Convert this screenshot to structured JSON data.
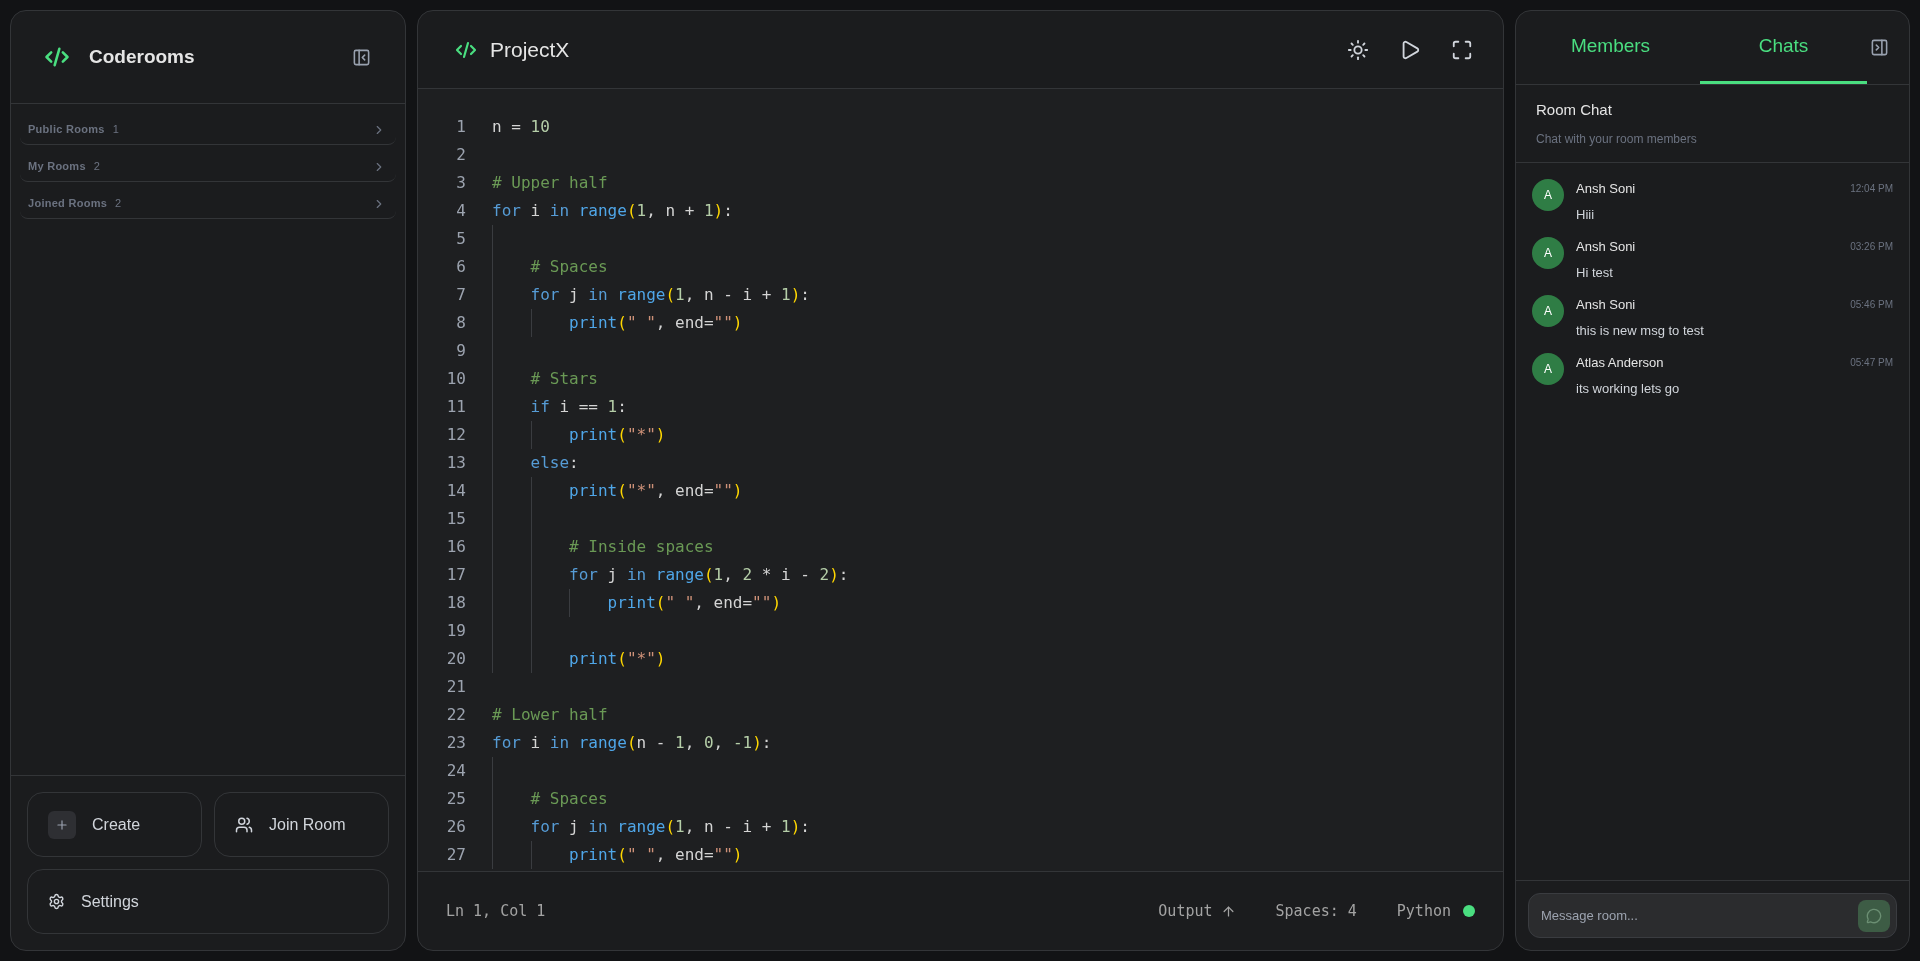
{
  "sidebar": {
    "brand": "Coderooms",
    "sections": [
      {
        "label": "Public Rooms",
        "count": "1"
      },
      {
        "label": "My Rooms",
        "count": "2"
      },
      {
        "label": "Joined Rooms",
        "count": "2"
      }
    ],
    "actions": [
      {
        "label": "Create",
        "kind": "create"
      },
      {
        "label": "Join Room",
        "kind": "join"
      },
      {
        "label": "Settings",
        "kind": "settings"
      }
    ]
  },
  "editor": {
    "title": "ProjectX",
    "lines": [
      {
        "number": "1",
        "tokens": [
          {
            "text": "n = ",
            "kind": "tx"
          },
          {
            "text": "10",
            "kind": "num"
          }
        ]
      },
      {
        "number": "2"
      },
      {
        "number": "3",
        "tokens": [
          {
            "text": "# Upper half",
            "kind": "cm"
          }
        ]
      },
      {
        "number": "4",
        "tokens": [
          {
            "text": "for",
            "kind": "kw"
          },
          {
            "text": " i ",
            "kind": "tx"
          },
          {
            "text": "in ",
            "kind": "kw"
          },
          {
            "text": "range",
            "kind": "fn"
          },
          {
            "text": "(",
            "kind": "pn"
          },
          {
            "text": "1",
            "kind": "num"
          },
          {
            "text": ", n + ",
            "kind": "tx"
          },
          {
            "text": "1",
            "kind": "num"
          },
          {
            "text": ")",
            "kind": "pn"
          },
          {
            "text": ":",
            "kind": "tx"
          }
        ]
      },
      {
        "number": "5"
      },
      {
        "number": "6",
        "tokens": [
          {
            "text": "    # Spaces",
            "kind": "cm"
          }
        ]
      },
      {
        "number": "7",
        "tokens": [
          {
            "text": "    for",
            "kind": "kw"
          },
          {
            "text": " j ",
            "kind": "tx"
          },
          {
            "text": "in ",
            "kind": "kw"
          },
          {
            "text": "range",
            "kind": "fn"
          },
          {
            "text": "(",
            "kind": "pn"
          },
          {
            "text": "1",
            "kind": "num"
          },
          {
            "text": ", n - i + ",
            "kind": "tx"
          },
          {
            "text": "1",
            "kind": "num"
          },
          {
            "text": ")",
            "kind": "pn"
          },
          {
            "text": ":",
            "kind": "tx"
          }
        ]
      },
      {
        "number": "8",
        "tokens": [
          {
            "text": "        print",
            "kind": "fn"
          },
          {
            "text": "(",
            "kind": "pn"
          },
          {
            "text": "\" \"",
            "kind": "str"
          },
          {
            "text": ", end=",
            "kind": "tx"
          },
          {
            "text": "\"\"",
            "kind": "str"
          },
          {
            "text": ")",
            "kind": "pn"
          }
        ]
      },
      {
        "number": "9"
      },
      {
        "number": "10",
        "tokens": [
          {
            "text": "    # Stars",
            "kind": "cm"
          }
        ]
      },
      {
        "number": "11",
        "tokens": [
          {
            "text": "    if",
            "kind": "kw"
          },
          {
            "text": " i == ",
            "kind": "tx"
          },
          {
            "text": "1",
            "kind": "num"
          },
          {
            "text": ":",
            "kind": "tx"
          }
        ]
      },
      {
        "number": "12",
        "tokens": [
          {
            "text": "        print",
            "kind": "fn"
          },
          {
            "text": "(",
            "kind": "pn"
          },
          {
            "text": "\"*\"",
            "kind": "str"
          },
          {
            "text": ")",
            "kind": "pn"
          }
        ]
      },
      {
        "number": "13",
        "tokens": [
          {
            "text": "    else",
            "kind": "kw"
          },
          {
            "text": ":",
            "kind": "tx"
          }
        ]
      },
      {
        "number": "14",
        "tokens": [
          {
            "text": "        print",
            "kind": "fn"
          },
          {
            "text": "(",
            "kind": "pn"
          },
          {
            "text": "\"*\"",
            "kind": "str"
          },
          {
            "text": ", end=",
            "kind": "tx"
          },
          {
            "text": "\"\"",
            "kind": "str"
          },
          {
            "text": ")",
            "kind": "pn"
          }
        ]
      },
      {
        "number": "15"
      },
      {
        "number": "16",
        "tokens": [
          {
            "text": "        # Inside spaces",
            "kind": "cm"
          }
        ]
      },
      {
        "number": "17",
        "tokens": [
          {
            "text": "        for",
            "kind": "kw"
          },
          {
            "text": " j ",
            "kind": "tx"
          },
          {
            "text": "in ",
            "kind": "kw"
          },
          {
            "text": "range",
            "kind": "fn"
          },
          {
            "text": "(",
            "kind": "pn"
          },
          {
            "text": "1",
            "kind": "num"
          },
          {
            "text": ", ",
            "kind": "tx"
          },
          {
            "text": "2",
            "kind": "num"
          },
          {
            "text": " * i - ",
            "kind": "tx"
          },
          {
            "text": "2",
            "kind": "num"
          },
          {
            "text": ")",
            "kind": "pn"
          },
          {
            "text": ":",
            "kind": "tx"
          }
        ]
      },
      {
        "number": "18",
        "tokens": [
          {
            "text": "            print",
            "kind": "fn"
          },
          {
            "text": "(",
            "kind": "pn"
          },
          {
            "text": "\" \"",
            "kind": "str"
          },
          {
            "text": ", end=",
            "kind": "tx"
          },
          {
            "text": "\"\"",
            "kind": "str"
          },
          {
            "text": ")",
            "kind": "pn"
          }
        ]
      },
      {
        "number": "19"
      },
      {
        "number": "20",
        "tokens": [
          {
            "text": "        print",
            "kind": "fn"
          },
          {
            "text": "(",
            "kind": "pn"
          },
          {
            "text": "\"*\"",
            "kind": "str"
          },
          {
            "text": ")",
            "kind": "pn"
          }
        ]
      },
      {
        "number": "21"
      },
      {
        "number": "22",
        "tokens": [
          {
            "text": "# Lower half",
            "kind": "cm"
          }
        ]
      },
      {
        "number": "23",
        "tokens": [
          {
            "text": "for",
            "kind": "kw"
          },
          {
            "text": " i ",
            "kind": "tx"
          },
          {
            "text": "in ",
            "kind": "kw"
          },
          {
            "text": "range",
            "kind": "fn"
          },
          {
            "text": "(",
            "kind": "pn"
          },
          {
            "text": "n - ",
            "kind": "tx"
          },
          {
            "text": "1",
            "kind": "num"
          },
          {
            "text": ", ",
            "kind": "tx"
          },
          {
            "text": "0",
            "kind": "num"
          },
          {
            "text": ", ",
            "kind": "tx"
          },
          {
            "text": "-1",
            "kind": "num"
          },
          {
            "text": ")",
            "kind": "pn"
          },
          {
            "text": ":",
            "kind": "tx"
          }
        ]
      },
      {
        "number": "24"
      },
      {
        "number": "25",
        "tokens": [
          {
            "text": "    # Spaces",
            "kind": "cm"
          }
        ]
      },
      {
        "number": "26",
        "tokens": [
          {
            "text": "    for",
            "kind": "kw"
          },
          {
            "text": " j ",
            "kind": "tx"
          },
          {
            "text": "in ",
            "kind": "kw"
          },
          {
            "text": "range",
            "kind": "fn"
          },
          {
            "text": "(",
            "kind": "pn"
          },
          {
            "text": "1",
            "kind": "num"
          },
          {
            "text": ", n - i + ",
            "kind": "tx"
          },
          {
            "text": "1",
            "kind": "num"
          },
          {
            "text": ")",
            "kind": "pn"
          },
          {
            "text": ":",
            "kind": "tx"
          }
        ]
      },
      {
        "number": "27",
        "tokens": [
          {
            "text": "        print",
            "kind": "fn"
          },
          {
            "text": "(",
            "kind": "pn"
          },
          {
            "text": "\" \"",
            "kind": "str"
          },
          {
            "text": ", end=",
            "kind": "tx"
          },
          {
            "text": "\"\"",
            "kind": "str"
          },
          {
            "text": ")",
            "kind": "pn"
          }
        ]
      }
    ],
    "status_bar": {
      "position": "Ln 1, Col 1",
      "output": "Output",
      "spaces": "Spaces: 4",
      "language": "Python",
      "connected": true
    }
  },
  "right_panel": {
    "tabs": [
      {
        "label": "Members",
        "selected": false
      },
      {
        "label": "Chats",
        "selected": true
      }
    ],
    "title": "Room Chat",
    "subtitle": "Chat with your room members",
    "messages": [
      {
        "avatar": "A",
        "author": "Ansh Soni",
        "time": "12:04 PM",
        "text": "Hiii"
      },
      {
        "avatar": "A",
        "author": "Ansh Soni",
        "time": "03:26 PM",
        "text": "Hi test"
      },
      {
        "avatar": "A",
        "author": "Ansh Soni",
        "time": "05:46 PM",
        "text": "this is new msg to test"
      },
      {
        "avatar": "A",
        "author": "Atlas Anderson",
        "time": "05:47 PM",
        "text": "its working lets go"
      }
    ],
    "input": {
      "placeholder": "Message room..."
    }
  }
}
